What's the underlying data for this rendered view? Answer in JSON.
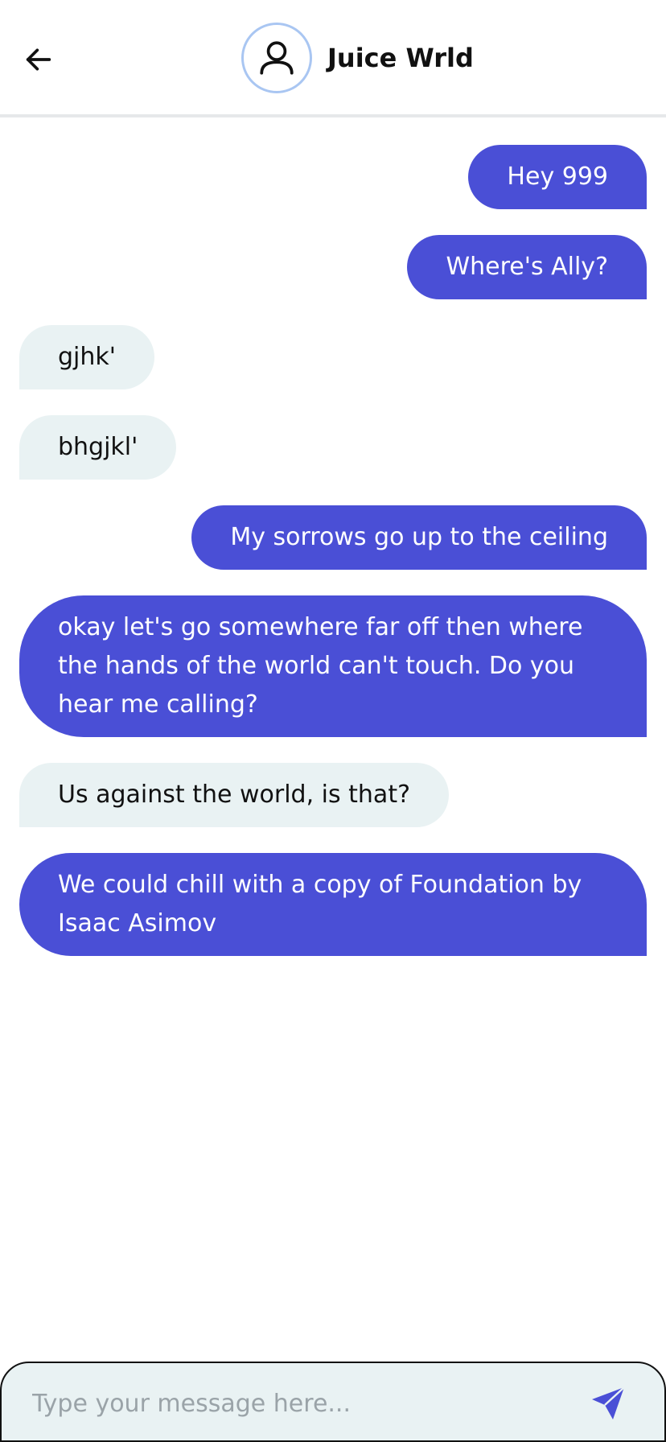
{
  "header": {
    "contact_name": "Juice Wrld",
    "back_icon": "arrow-left-icon",
    "avatar_icon": "user-icon"
  },
  "messages": [
    {
      "direction": "sent",
      "text": "Hey 999"
    },
    {
      "direction": "sent",
      "text": "Where's Ally?"
    },
    {
      "direction": "received",
      "text": "gjhk'"
    },
    {
      "direction": "received",
      "text": "bhgjkl'"
    },
    {
      "direction": "sent",
      "text": "My sorrows go up to the ceiling"
    },
    {
      "direction": "sent",
      "text": "okay let's go somewhere far off then where the hands of the world can't touch. Do you hear me calling?"
    },
    {
      "direction": "received",
      "text": "Us against the world, is that?"
    },
    {
      "direction": "sent",
      "text": "We could chill with a copy of Foundation by Isaac Asimov"
    }
  ],
  "composer": {
    "placeholder": "Type your message here...",
    "value": "",
    "send_icon": "paper-plane-icon"
  },
  "colors": {
    "sent_bubble": "#4a4fd6",
    "received_bubble": "#e9f2f3",
    "avatar_ring": "#a9c6f2",
    "send_icon": "#4a4fd6"
  }
}
